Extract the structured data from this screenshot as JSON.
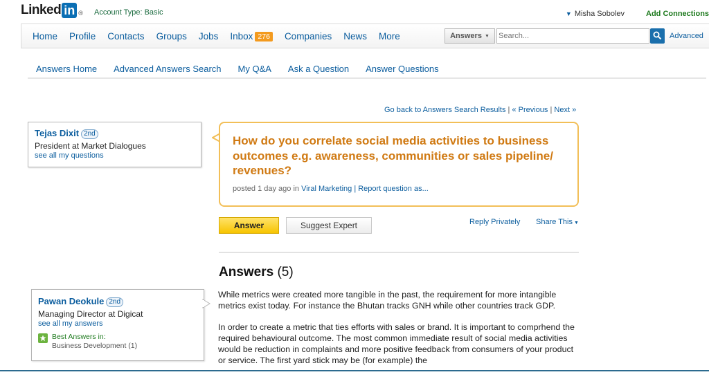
{
  "brand": {
    "logo_word": "Linked",
    "logo_in": "in",
    "logo_reg": "®",
    "account_type": "Account Type: Basic"
  },
  "topbar": {
    "user_name": "Misha Sobolev",
    "add_connections": "Add Connections"
  },
  "mainnav": {
    "items": [
      "Home",
      "Profile",
      "Contacts",
      "Groups",
      "Jobs",
      "Inbox",
      "Companies",
      "News",
      "More"
    ],
    "inbox_count": "276",
    "search_scope": "Answers",
    "search_placeholder": "Search...",
    "advanced": "Advanced"
  },
  "subnav": {
    "items": [
      "Answers Home",
      "Advanced Answers Search",
      "My Q&A",
      "Ask a Question",
      "Answer Questions"
    ]
  },
  "goback": {
    "back": "Go back to Answers Search Results",
    "sep": "|",
    "previous": "« Previous",
    "sep2": "|",
    "next": "Next »"
  },
  "asker": {
    "name": "Tejas Dixit",
    "degree": "2nd",
    "title": "President at Market Dialogues",
    "link": "see all my questions"
  },
  "question": {
    "text": "How do you correlate social media activities to business outcomes e.g. awareness, communities or sales pipeline/ revenues?",
    "posted": "posted 1 day ago in",
    "category": "Viral Marketing",
    "report": "| Report question as..."
  },
  "actions": {
    "answer": "Answer",
    "suggest": "Suggest Expert",
    "reply_privately": "Reply Privately",
    "share": "Share This"
  },
  "answers": {
    "heading": "Answers",
    "count": "(5)",
    "paragraph1": "While metrics were created more tangible in the past, the requirement for more intangible metrics exist today. For instance the Bhutan tracks GNH while other countries track GDP.",
    "paragraph2": "In order to create a metric that ties efforts with sales or brand. It is important to comprhend the required behavioural outcome. The most common immediate result of social media activities would be reduction in complaints and more positive feedback from consumers of your product or service. The first yard stick may be (for example) the"
  },
  "answerer": {
    "name": "Pawan Deokule",
    "degree": "2nd",
    "title": "Managing Director at Digicat",
    "link": "see all my answers",
    "best_label": "Best Answers in:",
    "best_category": "Business Development (1)"
  }
}
